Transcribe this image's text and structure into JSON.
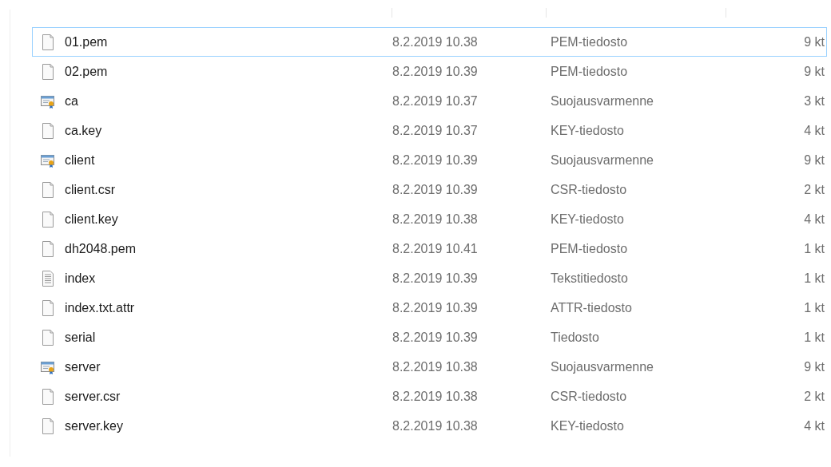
{
  "files": [
    {
      "name": "01.pem",
      "date": "8.2.2019 10.38",
      "type": "PEM-tiedosto",
      "size": "9 kt",
      "kind": "blank",
      "focused": true
    },
    {
      "name": "02.pem",
      "date": "8.2.2019 10.39",
      "type": "PEM-tiedosto",
      "size": "9 kt",
      "kind": "blank",
      "focused": false
    },
    {
      "name": "ca",
      "date": "8.2.2019 10.37",
      "type": "Suojausvarmenne",
      "size": "3 kt",
      "kind": "certificate",
      "focused": false
    },
    {
      "name": "ca.key",
      "date": "8.2.2019 10.37",
      "type": "KEY-tiedosto",
      "size": "4 kt",
      "kind": "blank",
      "focused": false
    },
    {
      "name": "client",
      "date": "8.2.2019 10.39",
      "type": "Suojausvarmenne",
      "size": "9 kt",
      "kind": "certificate",
      "focused": false
    },
    {
      "name": "client.csr",
      "date": "8.2.2019 10.39",
      "type": "CSR-tiedosto",
      "size": "2 kt",
      "kind": "blank",
      "focused": false
    },
    {
      "name": "client.key",
      "date": "8.2.2019 10.38",
      "type": "KEY-tiedosto",
      "size": "4 kt",
      "kind": "blank",
      "focused": false
    },
    {
      "name": "dh2048.pem",
      "date": "8.2.2019 10.41",
      "type": "PEM-tiedosto",
      "size": "1 kt",
      "kind": "blank",
      "focused": false
    },
    {
      "name": "index",
      "date": "8.2.2019 10.39",
      "type": "Tekstitiedosto",
      "size": "1 kt",
      "kind": "text",
      "focused": false
    },
    {
      "name": "index.txt.attr",
      "date": "8.2.2019 10.39",
      "type": "ATTR-tiedosto",
      "size": "1 kt",
      "kind": "blank",
      "focused": false
    },
    {
      "name": "serial",
      "date": "8.2.2019 10.39",
      "type": "Tiedosto",
      "size": "1 kt",
      "kind": "blank",
      "focused": false
    },
    {
      "name": "server",
      "date": "8.2.2019 10.38",
      "type": "Suojausvarmenne",
      "size": "9 kt",
      "kind": "certificate",
      "focused": false
    },
    {
      "name": "server.csr",
      "date": "8.2.2019 10.38",
      "type": "CSR-tiedosto",
      "size": "2 kt",
      "kind": "blank",
      "focused": false
    },
    {
      "name": "server.key",
      "date": "8.2.2019 10.38",
      "type": "KEY-tiedosto",
      "size": "4 kt",
      "kind": "blank",
      "focused": false
    }
  ]
}
